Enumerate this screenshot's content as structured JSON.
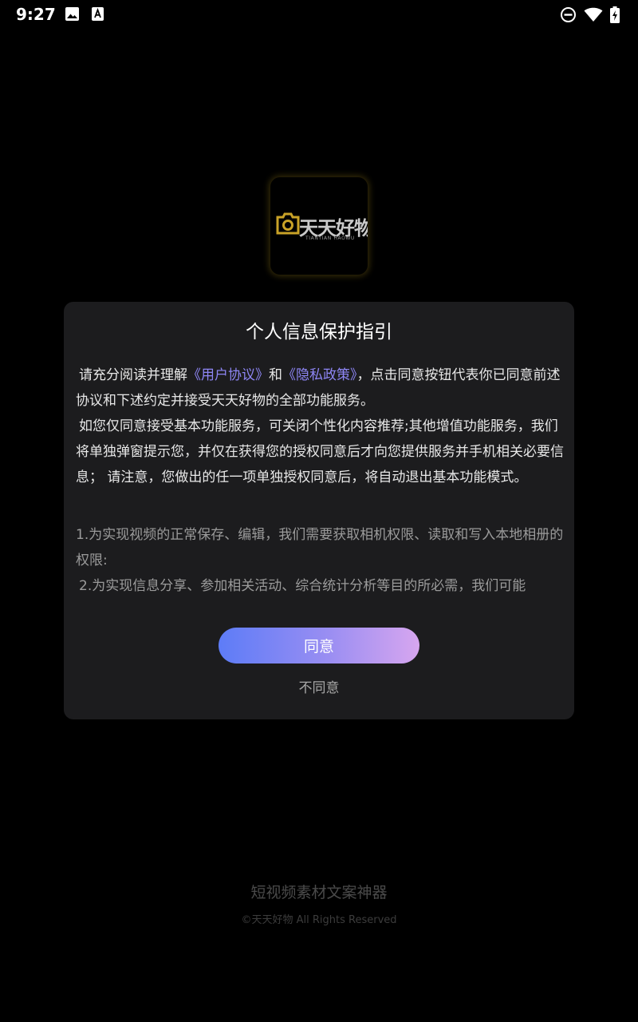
{
  "status_bar": {
    "time": "9:27",
    "icons": [
      "image-icon",
      "a-notification-icon",
      "do-not-disturb-icon",
      "wifi-icon",
      "battery-charging-icon"
    ]
  },
  "logo": {
    "text": "天天好物",
    "subtext": "TIANTIAN HAOWU",
    "accent_color": "#c9a227"
  },
  "dialog": {
    "title": "个人信息保护指引",
    "para1": {
      "pre": "请充分阅读并理解",
      "link1": "《用户协议》",
      "mid": "和",
      "link2": "《隐私政策》",
      "post": "，点击同意按钮代表你已同意前述协议和下述约定并接受天天好物的全部功能服务。"
    },
    "para2": "如您仅同意接受基本功能服务，可关闭个性化内容推荐;其他增值功能服务，我们将单独弹窗提示您，并仅在获得您的授权同意后才向您提供服务并手机相关必要信息； 请注意，您做出的任一项单独授权同意后，将自动退出基本功能模式。",
    "item1": "1.为实现视频的正常保存、编辑，我们需要获取相机权限、读取和写入本地相册的权限:",
    "item2": "2.为实现信息分享、参加相关活动、综合统计分析等目的所必需，我们可能",
    "agree_label": "同意",
    "disagree_label": "不同意",
    "link_color": "#8e86f5"
  },
  "footer": {
    "slogan": "短视频素材文案神器",
    "copyright": "©天天好物 All Rights Reserved"
  }
}
